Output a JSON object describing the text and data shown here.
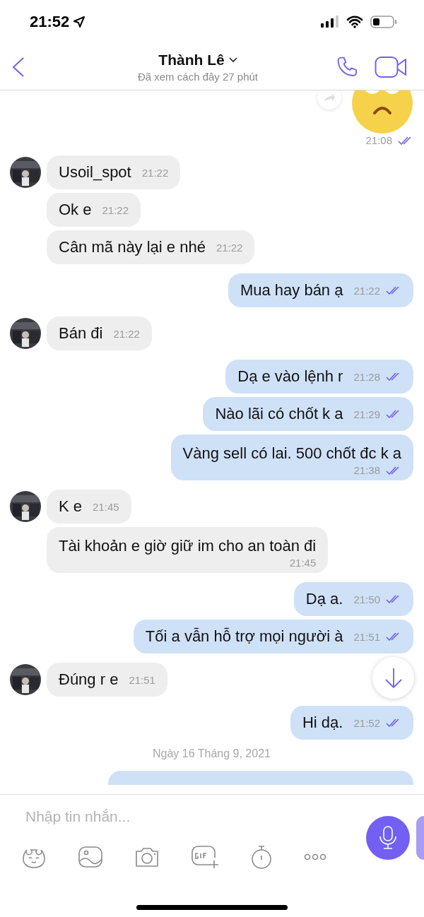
{
  "status_bar": {
    "time": "21:52"
  },
  "header": {
    "title": "Thành Lê",
    "subtitle": "Đã xem cách đây 27 phút"
  },
  "messages": [
    {
      "kind": "sticker",
      "time": "21:08",
      "read": true
    },
    {
      "kind": "incoming",
      "text": "Usoil_spot",
      "time": "21:22"
    },
    {
      "kind": "incoming",
      "text": "Ok e",
      "time": "21:22"
    },
    {
      "kind": "incoming",
      "text": "Cân mã này lại e nhé",
      "time": "21:22"
    },
    {
      "kind": "outgoing",
      "text": "Mua hay bán ạ",
      "time": "21:22",
      "read": true
    },
    {
      "kind": "incoming",
      "text": "Bán đi",
      "time": "21:22"
    },
    {
      "kind": "outgoing",
      "text": "Dạ e vào lệnh r",
      "time": "21:28",
      "read": true
    },
    {
      "kind": "outgoing",
      "text": "Nào lãi có chốt k a",
      "time": "21:29",
      "read": true
    },
    {
      "kind": "outgoing",
      "text": "Vàng sell có lai. 500 chốt đc k a",
      "time": "21:38",
      "read": true,
      "stacked": true
    },
    {
      "kind": "incoming",
      "text": "K e",
      "time": "21:45"
    },
    {
      "kind": "incoming",
      "text": "Tài khoản e giờ giữ im cho an toàn đi",
      "time": "21:45",
      "stacked": true
    },
    {
      "kind": "outgoing",
      "text": "Dạ a.",
      "time": "21:50",
      "read": true
    },
    {
      "kind": "outgoing",
      "text": "Tối a vẫn hỗ trợ mọi người à",
      "time": "21:51",
      "read": true
    },
    {
      "kind": "incoming",
      "text": "Đúng r e",
      "time": "21:51"
    },
    {
      "kind": "outgoing",
      "text": "Hi dạ.",
      "time": "21:52",
      "read": true
    },
    {
      "kind": "date",
      "text": "Ngày 16 Tháng 9, 2021"
    },
    {
      "kind": "cut"
    }
  ],
  "composer": {
    "placeholder": "Nhập tin nhắn..."
  }
}
